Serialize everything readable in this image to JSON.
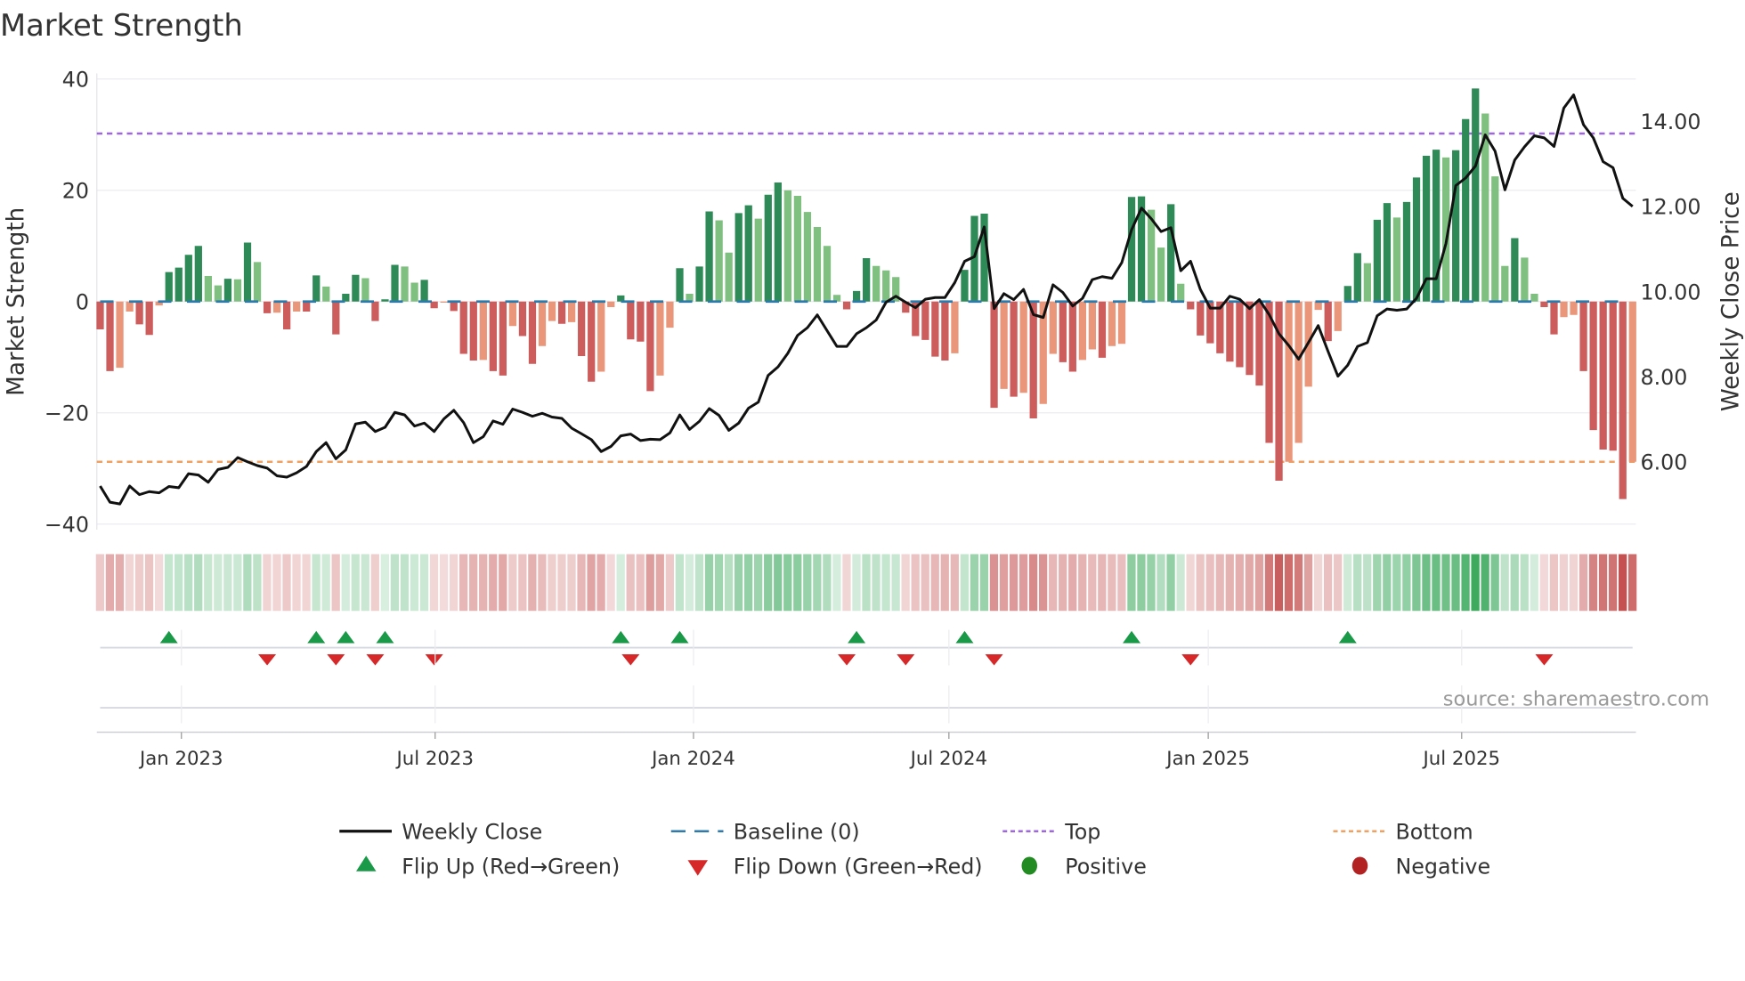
{
  "chart_data": {
    "type": "bar",
    "title": "Market Strength",
    "ylabel": "Market Strength",
    "y2label": "Weekly Close Price",
    "ylim": [
      -40,
      40
    ],
    "y2lim": [
      4.5,
      15.2
    ],
    "yticks": [
      {
        "v": 40,
        "label": "40"
      },
      {
        "v": 20,
        "label": "20"
      },
      {
        "v": 0,
        "label": "0"
      },
      {
        "v": -20,
        "label": "−20"
      },
      {
        "v": -40,
        "label": "−40"
      }
    ],
    "y2ticks": [
      {
        "v": 14,
        "label": "14.00"
      },
      {
        "v": 12,
        "label": "12.00"
      },
      {
        "v": 10,
        "label": "10.00"
      },
      {
        "v": 8,
        "label": "8.00"
      },
      {
        "v": 6,
        "label": "6.00"
      }
    ],
    "xticks": [
      {
        "week": 8.27,
        "label": "Jan 2023"
      },
      {
        "week": 34.1,
        "label": "Jul 2023"
      },
      {
        "week": 60.4,
        "label": "Jan 2024"
      },
      {
        "week": 86.4,
        "label": "Jul 2024"
      },
      {
        "week": 112.8,
        "label": "Jan 2025"
      },
      {
        "week": 138.6,
        "label": "Jul 2025"
      }
    ],
    "top_line": 30.2,
    "bottom_line": -28.8,
    "grid": true,
    "strength": [
      -5,
      -12.5,
      -11.9,
      -1.8,
      -4.1,
      -6,
      -0.7,
      5.3,
      6.1,
      8.4,
      10,
      4.6,
      2.9,
      4.1,
      4,
      10.6,
      7.1,
      -2.1,
      -2,
      -5,
      -1.8,
      -1.8,
      4.7,
      2.7,
      -5.9,
      1.4,
      4.8,
      4.2,
      -3.5,
      0.4,
      6.6,
      6.3,
      3.4,
      3.9,
      -1.2,
      -0.2,
      -1.7,
      -9.4,
      -10.6,
      -10.5,
      -12.5,
      -13.3,
      -4.4,
      -6.2,
      -11.2,
      -8,
      -3.5,
      -4,
      -3.7,
      -9.8,
      -14.4,
      -12.6,
      -1,
      1.1,
      -6.8,
      -7.2,
      -16.1,
      -13.3,
      -4.7,
      6,
      1.4,
      6.3,
      16.2,
      14.6,
      8.8,
      15.9,
      17.3,
      14.9,
      19.2,
      21.4,
      20,
      19,
      16.1,
      13.4,
      10,
      1.2,
      -1.4,
      1.9,
      7.8,
      6.4,
      5.6,
      4.4,
      -2,
      -6.2,
      -6.9,
      -9.9,
      -10.6,
      -9.3,
      5.7,
      15.4,
      15.8,
      -19.1,
      -15.7,
      -17.1,
      -16.4,
      -21,
      -18.4,
      -9.4,
      -10.9,
      -12.6,
      -10.5,
      -8.6,
      -10.1,
      -8,
      -7.6,
      18.8,
      18.9,
      16.5,
      9.7,
      17.5,
      3.2,
      -1.4,
      -6.1,
      -7.5,
      -9.3,
      -10.8,
      -11.8,
      -13.2,
      -15.1,
      -25.4,
      -32.2,
      -28.8,
      -25.4,
      -15.3,
      -1.5,
      -7.1,
      -5.3,
      2.8,
      8.7,
      6.9,
      14.7,
      17.7,
      15.1,
      17.9,
      22.3,
      26.2,
      27.3,
      25.9,
      27.2,
      32.8,
      38.3,
      33.8,
      22.5,
      6.4,
      11.4,
      7.9,
      1.4,
      -1,
      -5.9,
      -2.8,
      -2.4,
      -12.5,
      -23.1,
      -26.6,
      -26.8,
      -35.5,
      -28.8
    ],
    "weekly_close": [
      5.43,
      5.05,
      5.01,
      5.43,
      5.23,
      5.3,
      5.27,
      5.42,
      5.39,
      5.72,
      5.69,
      5.52,
      5.82,
      5.87,
      6.1,
      6.0,
      5.91,
      5.85,
      5.67,
      5.64,
      5.74,
      5.89,
      6.24,
      6.45,
      6.07,
      6.28,
      6.89,
      6.93,
      6.71,
      6.81,
      7.16,
      7.1,
      6.84,
      6.91,
      6.71,
      7.01,
      7.21,
      6.92,
      6.45,
      6.59,
      6.96,
      6.88,
      7.24,
      7.16,
      7.07,
      7.14,
      7.05,
      7.02,
      6.79,
      6.66,
      6.52,
      6.24,
      6.36,
      6.61,
      6.65,
      6.5,
      6.53,
      6.52,
      6.68,
      7.1,
      6.76,
      6.95,
      7.25,
      7.09,
      6.74,
      6.91,
      7.26,
      7.4,
      8.03,
      8.23,
      8.55,
      8.97,
      9.15,
      9.45,
      9.08,
      8.71,
      8.71,
      9.01,
      9.15,
      9.33,
      9.75,
      9.89,
      9.75,
      9.62,
      9.82,
      9.86,
      9.86,
      10.21,
      10.71,
      10.82,
      11.52,
      9.6,
      9.95,
      9.81,
      10.05,
      9.46,
      9.39,
      10.16,
      9.98,
      9.66,
      9.84,
      10.28,
      10.35,
      10.31,
      10.68,
      11.45,
      11.96,
      11.71,
      11.41,
      11.5,
      10.49,
      10.71,
      10.05,
      9.61,
      9.61,
      9.89,
      9.82,
      9.6,
      9.81,
      9.46,
      9.01,
      8.73,
      8.41,
      8.8,
      9.2,
      8.59,
      8.01,
      8.27,
      8.71,
      8.8,
      9.43,
      9.59,
      9.56,
      9.59,
      9.84,
      10.3,
      10.3,
      11.13,
      12.49,
      12.67,
      12.95,
      13.68,
      13.3,
      12.39,
      13.09,
      13.4,
      13.66,
      13.61,
      13.41,
      14.31,
      14.62,
      13.92,
      13.61,
      13.05,
      12.91,
      12.19,
      12.0
    ],
    "flip_up_weeks": [
      7,
      22,
      25,
      29,
      53,
      59,
      77,
      88,
      105,
      127
    ],
    "flip_down_weeks": [
      17,
      24,
      28,
      34,
      54,
      76,
      82,
      91,
      111,
      147
    ],
    "legend": [
      {
        "key": "close",
        "label": "Weekly Close"
      },
      {
        "key": "baseline",
        "label": "Baseline (0)"
      },
      {
        "key": "top",
        "label": "Top"
      },
      {
        "key": "bottom",
        "label": "Bottom"
      },
      {
        "key": "flip_up",
        "label": "Flip Up (Red→Green)"
      },
      {
        "key": "flip_down",
        "label": "Flip Down (Green→Red)"
      },
      {
        "key": "positive",
        "label": "Positive"
      },
      {
        "key": "negative",
        "label": "Negative"
      }
    ],
    "legend_placement": "bottom",
    "source": "source: sharemaestro.com",
    "colors": {
      "pos_dark": "#2e8b57",
      "pos_light": "#7fbf7f",
      "neg_dark": "#cd5c5c",
      "neg_light": "#e9967a",
      "close": "#111111",
      "baseline": "#2e7bab",
      "top": "#a066e0",
      "bottom": "#f0a060",
      "flip_up": "#1a9a48",
      "flip_down": "#d62828",
      "positive": "#228b22",
      "negative": "#b22222"
    }
  }
}
